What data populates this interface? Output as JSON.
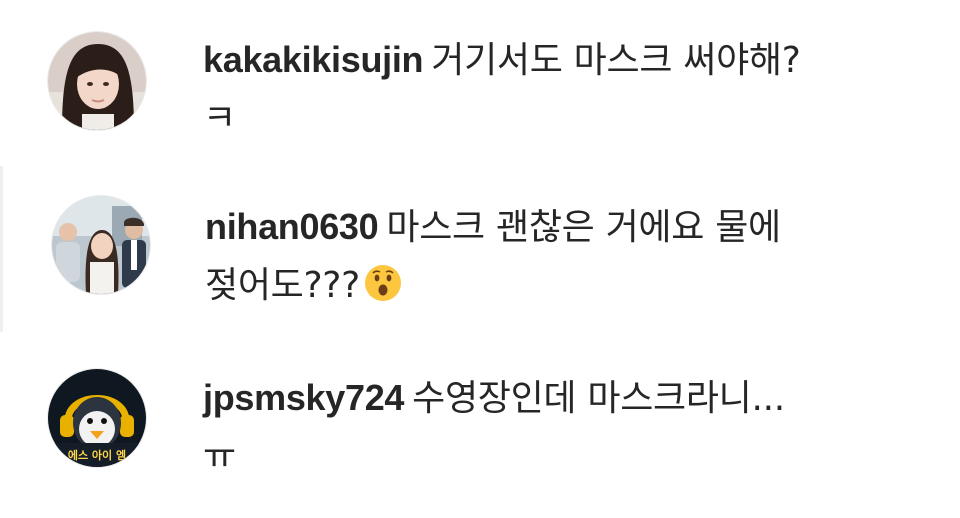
{
  "comments": [
    {
      "username": "kakakikisujin",
      "text_line1": "거기서도 마스크 써야해?",
      "text_line2": "ㅋ",
      "avatar": "user-photo-avatar"
    },
    {
      "username": "nihan0630",
      "text_line1": "마스크 괜찮은 거에요 물에",
      "text_line2": "젖어도???",
      "emoji": "surprised-face-emoji",
      "avatar": "group-photo-avatar"
    },
    {
      "username": "jpsmsky724",
      "text_line1": "수영장인데 마스크라니...",
      "text_line2": "ㅠ",
      "avatar": "penguin-character-avatar",
      "avatar_caption": "에스 아이 엠"
    }
  ]
}
